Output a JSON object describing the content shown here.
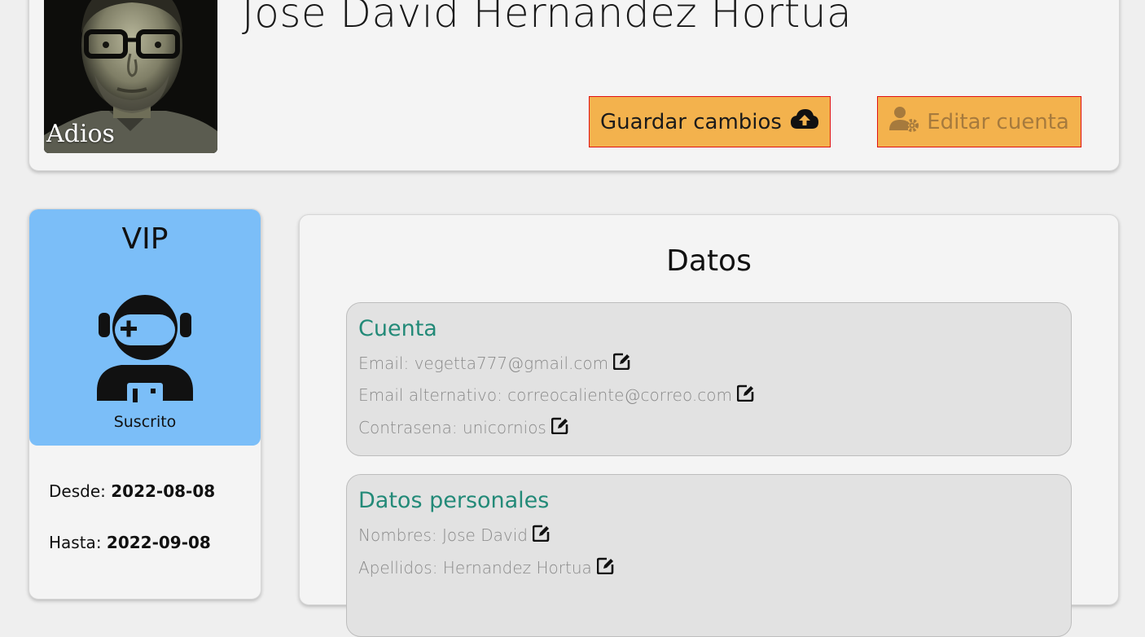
{
  "profile": {
    "name": "Jose David Hernandez Hortua",
    "avatar_caption": "Adios",
    "buttons": {
      "save_label": "Guardar cambios",
      "save_icon": "cloud-upload-icon",
      "edit_label": "Editar cuenta",
      "edit_icon": "user-gear-icon"
    }
  },
  "subscription": {
    "tier": "VIP",
    "icon": "astronaut-icon",
    "status": "Suscrito",
    "since_label": "Desde:",
    "since_value": "2022-08-08",
    "until_label": "Hasta:",
    "until_value": "2022-09-08"
  },
  "data_panel": {
    "title": "Datos",
    "account": {
      "title": "Cuenta",
      "email": "Email: vegetta777@gmail.com",
      "alt_email": "Email alternativo: correocaliente@correo.com",
      "password": "Contrasena: unicornios"
    },
    "personal": {
      "title": "Datos personales",
      "first_names": "Nombres: Jose David",
      "last_names": "Apellidos: Hernandez Hortua"
    }
  },
  "colors": {
    "page_bg": "#efefef",
    "card_bg": "#f4f4f4",
    "button_bg": "#f3b24d",
    "button_border": "#e01212",
    "vip_bg": "#7bbef8",
    "section_bg": "#e2e2e2",
    "section_title": "#238a78",
    "field_text": "#8a8a8a"
  }
}
